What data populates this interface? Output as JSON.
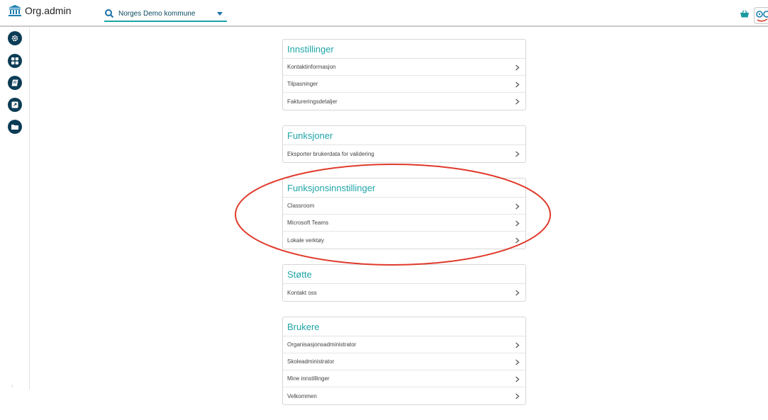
{
  "header": {
    "brand": "Org.admin",
    "org_select_value": "Norges Demo kommune"
  },
  "icons": {
    "brand": "institution-icon",
    "search": "search-icon",
    "cart": "shopping-basket-icon",
    "help": "help-icon"
  },
  "colors": {
    "accent": "#1fa5a8",
    "sidebar_button": "#0c3c55",
    "annotation": "#e03a2b"
  },
  "sidebar": {
    "items": [
      {
        "icon": "gear-icon"
      },
      {
        "icon": "grid-icon"
      },
      {
        "icon": "book-icon"
      },
      {
        "icon": "external-link-icon"
      },
      {
        "icon": "folder-icon"
      }
    ]
  },
  "sections": [
    {
      "title": "Innstillinger",
      "items": [
        "Kontaktinformasjon",
        "Tilpasninger",
        "Faktureringsdetaljer"
      ]
    },
    {
      "title": "Funksjoner",
      "items": [
        "Eksporter brukerdata for validering"
      ]
    },
    {
      "title": "Funksjonsinnstillinger",
      "items": [
        "Classroom",
        "Microsoft Teams",
        "Lokale verktøy"
      ]
    },
    {
      "title": "Støtte",
      "items": [
        "Kontakt oss"
      ]
    },
    {
      "title": "Brukere",
      "items": [
        "Organisasjonsadministrator",
        "Skoleadministrator",
        "Mine innstillinger",
        "Velkommen"
      ]
    }
  ]
}
